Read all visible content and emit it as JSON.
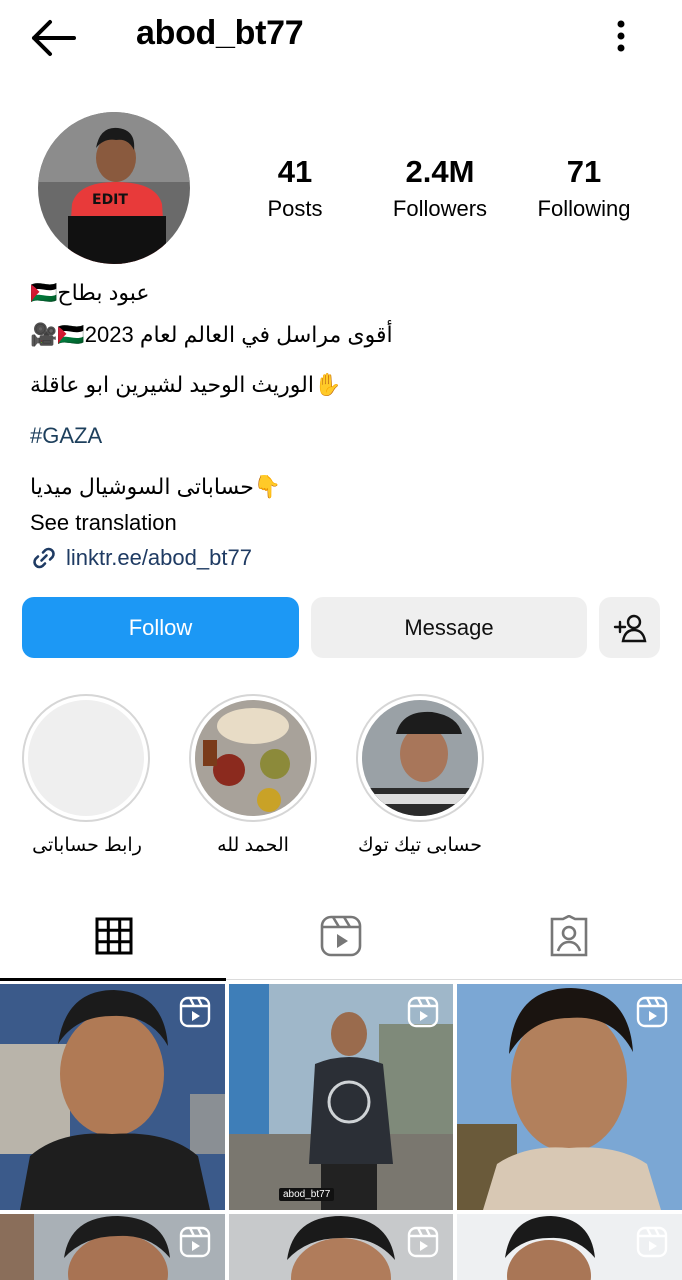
{
  "header": {
    "username": "abod_bt77",
    "back_icon": "arrow-left-icon",
    "more_icon": "more-vertical-icon"
  },
  "stats": [
    {
      "value": "41",
      "label": "Posts"
    },
    {
      "value": "2.4M",
      "label": "Followers"
    },
    {
      "value": "71",
      "label": "Following"
    }
  ],
  "bio": {
    "name": "عبود بطاح🇵🇸",
    "line1": "🎥🇵🇸أقوى مراسل في العالم  لعام 2023",
    "line2": "✋الوريث الوحيد لشيرين ابو عاقلة",
    "hashtag": "#GAZA",
    "line3": "👇حساباتى السوشيال ميديا",
    "see_translation": "See translation",
    "link": "linktr.ee/abod_bt77"
  },
  "buttons": {
    "follow": "Follow",
    "message": "Message"
  },
  "highlights": [
    {
      "label": "رابط حساباتى"
    },
    {
      "label": "الحمد لله"
    },
    {
      "label": "حسابى تيك توك"
    }
  ],
  "tabs": [
    "grid-icon",
    "reels-icon",
    "tagged-icon"
  ],
  "posts": [
    {
      "watermark": ""
    },
    {
      "watermark": "abod_bt77"
    },
    {
      "watermark": ""
    },
    {
      "watermark": ""
    },
    {
      "watermark": ""
    },
    {
      "watermark": ""
    }
  ],
  "colors": {
    "follow_blue": "#1c98f5",
    "secondary_gray": "#efefef",
    "hashtag": "#1d3f5c"
  }
}
